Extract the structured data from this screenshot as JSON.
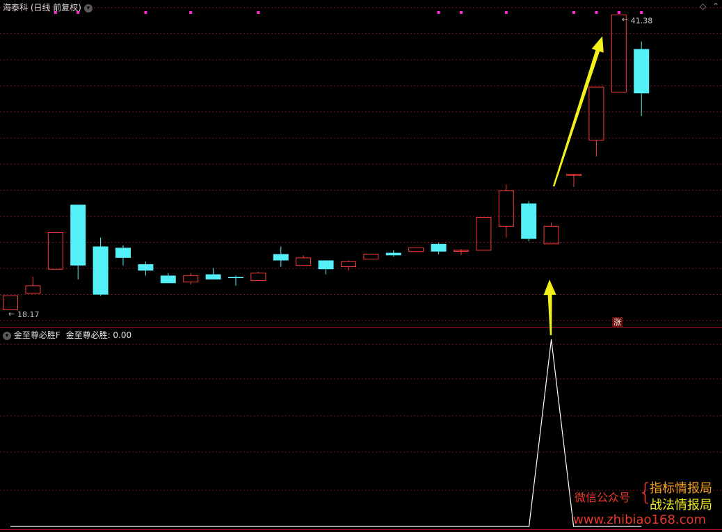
{
  "header": {
    "title": "海泰科 (日线 前复权)",
    "menu_icon": "chevron-down-icon",
    "corner_icon": "diamond-icon"
  },
  "indicator": {
    "name": "金至尊必胜F",
    "value_label": "金至尊必胜: 0.00",
    "menu_icon": "chevron-down-icon"
  },
  "colors": {
    "background": "#000000",
    "up": "#ff3b3b",
    "down": "#54f0f8",
    "grid": "#7a1a1a",
    "marker_dots": "#ff2bd6",
    "arrow": "#f2f21a",
    "indicator_line": "#ffffff",
    "divider": "#a01818"
  },
  "chart_data": {
    "type": "candlestick",
    "y_range": [
      17.5,
      42.5
    ],
    "candles": [
      {
        "open": 18.3,
        "high": 19.4,
        "low": 18.3,
        "close": 19.4
      },
      {
        "open": 19.6,
        "high": 20.9,
        "low": 19.6,
        "close": 20.2
      },
      {
        "open": 21.5,
        "high": 24.4,
        "low": 21.5,
        "close": 24.4
      },
      {
        "open": 26.6,
        "high": 26.6,
        "low": 20.7,
        "close": 21.8
      },
      {
        "open": 23.3,
        "high": 24.0,
        "low": 19.4,
        "close": 19.5
      },
      {
        "open": 23.2,
        "high": 23.4,
        "low": 21.8,
        "close": 22.4
      },
      {
        "open": 21.9,
        "high": 22.1,
        "low": 21.0,
        "close": 21.4
      },
      {
        "open": 21.0,
        "high": 21.2,
        "low": 20.4,
        "close": 20.4
      },
      {
        "open": 20.5,
        "high": 21.2,
        "low": 20.3,
        "close": 21.0
      },
      {
        "open": 21.1,
        "high": 21.6,
        "low": 20.7,
        "close": 20.7
      },
      {
        "open": 20.9,
        "high": 21.0,
        "low": 20.2,
        "close": 20.8
      },
      {
        "open": 20.6,
        "high": 21.3,
        "low": 20.6,
        "close": 21.2
      },
      {
        "open": 22.7,
        "high": 23.3,
        "low": 21.7,
        "close": 22.2
      },
      {
        "open": 21.8,
        "high": 22.6,
        "low": 21.8,
        "close": 22.4
      },
      {
        "open": 22.2,
        "high": 22.2,
        "low": 21.1,
        "close": 21.5
      },
      {
        "open": 21.7,
        "high": 22.2,
        "low": 21.4,
        "close": 22.1
      },
      {
        "open": 22.3,
        "high": 22.7,
        "low": 22.3,
        "close": 22.7
      },
      {
        "open": 22.8,
        "high": 23.0,
        "low": 22.5,
        "close": 22.6
      },
      {
        "open": 22.9,
        "high": 23.2,
        "low": 22.9,
        "close": 23.2
      },
      {
        "open": 23.5,
        "high": 23.6,
        "low": 22.7,
        "close": 22.9
      },
      {
        "open": 23.0,
        "high": 23.1,
        "low": 22.6,
        "close": 23.0
      },
      {
        "open": 23.0,
        "high": 25.6,
        "low": 23.0,
        "close": 25.6
      },
      {
        "open": 24.9,
        "high": 28.2,
        "low": 24.0,
        "close": 27.7
      },
      {
        "open": 26.7,
        "high": 26.9,
        "low": 23.7,
        "close": 23.9
      },
      {
        "open": 23.5,
        "high": 25.2,
        "low": 23.5,
        "close": 24.9
      },
      {
        "open": 29.0,
        "high": 29.0,
        "low": 28.0,
        "close": 29.0
      },
      {
        "open": 31.7,
        "high": 35.9,
        "low": 30.4,
        "close": 35.9
      },
      {
        "open": 35.5,
        "high": 41.6,
        "low": 35.5,
        "close": 41.6
      },
      {
        "open": 38.9,
        "high": 39.5,
        "low": 33.6,
        "close": 35.4
      }
    ],
    "max_label": "41.38",
    "min_label": "18.17",
    "signal_marks": [
      2,
      3,
      6,
      8,
      11,
      19,
      20,
      22,
      25,
      26,
      27,
      28
    ],
    "indicator_values": [
      0,
      0,
      0,
      0,
      0,
      0,
      0,
      0,
      0,
      0,
      0,
      0,
      0,
      0,
      0,
      0,
      0,
      0,
      0,
      0,
      0,
      0,
      0,
      0,
      1,
      0,
      0,
      0,
      0
    ],
    "up_label": "涨"
  },
  "watermark": {
    "wechat_label": "微信公众号",
    "brace": "{",
    "line1": "指标情报局",
    "line2": "战法情报局",
    "url": "www.zhibiao168.com"
  }
}
